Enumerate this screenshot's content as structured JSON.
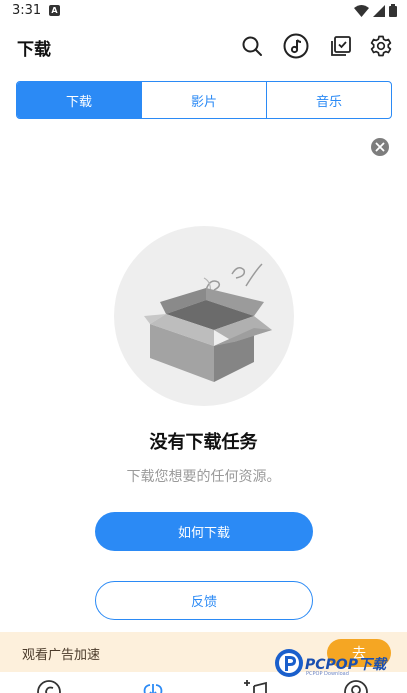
{
  "status_bar": {
    "time": "3:31",
    "notif_letter": "A"
  },
  "header": {
    "title": "下载"
  },
  "icons": {
    "search": "search-icon",
    "music": "music-disc-icon",
    "checklist": "edit-check-icon",
    "settings": "gear-icon",
    "close": "close-icon"
  },
  "tabs": [
    {
      "label": "下载",
      "active": true
    },
    {
      "label": "影片",
      "active": false
    },
    {
      "label": "音乐",
      "active": false
    }
  ],
  "empty_state": {
    "title": "没有下载任务",
    "subtitle": "下载您想要的任何资源。",
    "primary_button": "如何下载",
    "secondary_button": "反馈"
  },
  "ad_banner": {
    "text": "观看广告加速",
    "button": "去"
  },
  "watermark": {
    "brand": "PCPOP下载",
    "sub": "PCPOP Download"
  },
  "colors": {
    "accent": "#2b8af5",
    "ad_bg": "#fdf0dc",
    "ad_button": "#f5a623"
  }
}
